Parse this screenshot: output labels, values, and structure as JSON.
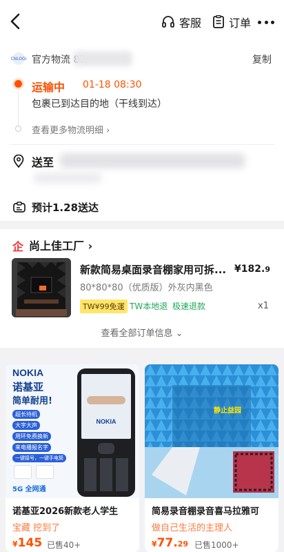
{
  "header": {
    "service_label": "客服",
    "order_label": "订单"
  },
  "logistics": {
    "carrier_logo": "CNLOGI",
    "carrier_prefix": "官方物流 ",
    "tracking_partial": "87",
    "copy_label": "复制",
    "status": "运输中",
    "status_time": "01-18 08:30",
    "status_desc": "包裹已到达目的地（干线到达）",
    "more_detail": "查看更多物流明细 ›",
    "send_to_label": "送至",
    "eta": "预计1.28送达",
    "accent_color": "#ff5000"
  },
  "shop": {
    "icon": "企",
    "name": "尚上佳工厂 ›",
    "product": {
      "title": "新款简易桌面录音棚家用可拆...",
      "price_main": "¥182.",
      "price_decimal": "9",
      "spec": "80*80*80（优质版）外灰内黑色",
      "tags": [
        "TW¥99免運",
        "TW本地退",
        "极速退款"
      ],
      "quantity": "x1"
    },
    "view_all": "查看全部订单信息 ⌄"
  },
  "recommend": [
    {
      "title": "诺基亚2026新款老人学生",
      "subtitle": "宝藏 挖到了",
      "price_symbol": "¥",
      "price": "145",
      "sold": "已售40+",
      "image_text": {
        "brand": "NOKIA",
        "brand_cn": "诺基亚",
        "slogan": "简单耐用!",
        "features": [
          "超长待机",
          "大字大声",
          "用环免费换新",
          "来电播报名字",
          "一键接号，一键手电筒"
        ],
        "network": "5G 全网通",
        "phone_logo": "NOKIA"
      }
    },
    {
      "title": "简易录音棚录音喜马拉雅可",
      "subtitle": "做自己生活的主理人",
      "price_symbol": "¥",
      "price": "77.",
      "price_decimal": "29",
      "sold": "已售1000+",
      "image_text": {
        "sign": "静止益园"
      }
    }
  ]
}
